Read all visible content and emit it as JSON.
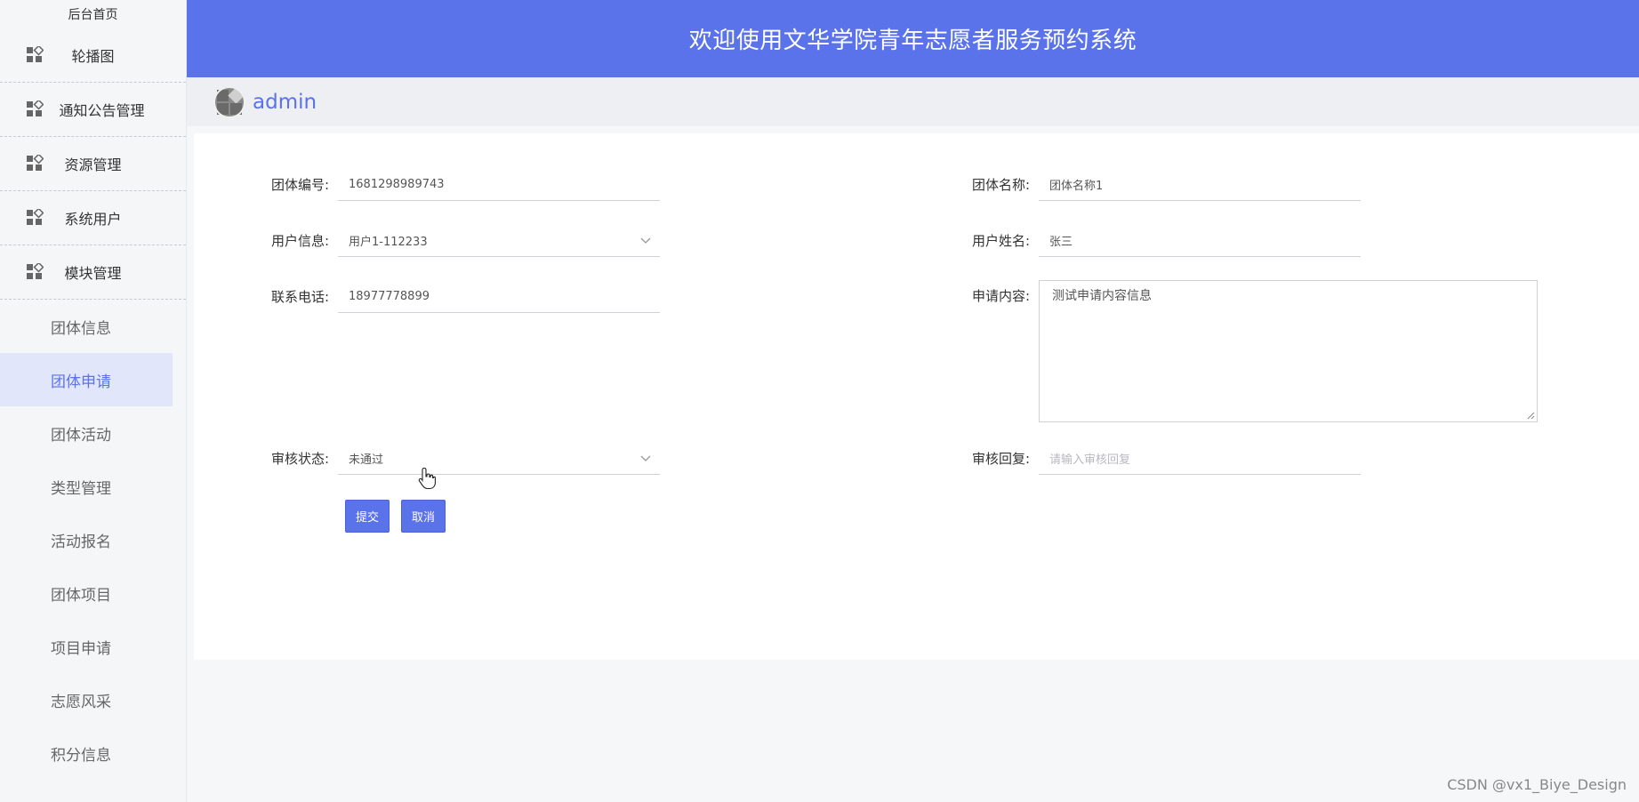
{
  "sidebar": {
    "home": "后台首页",
    "groups": [
      {
        "label": "轮播图",
        "icon": "grid-icon"
      },
      {
        "label": "通知公告管理",
        "icon": "grid-icon"
      },
      {
        "label": "资源管理",
        "icon": "grid-icon"
      },
      {
        "label": "系统用户",
        "icon": "grid-icon"
      },
      {
        "label": "模块管理",
        "icon": "grid-icon"
      }
    ],
    "items": [
      {
        "label": "团体信息"
      },
      {
        "label": "团体申请",
        "active": true
      },
      {
        "label": "团体活动"
      },
      {
        "label": "类型管理"
      },
      {
        "label": "活动报名"
      },
      {
        "label": "团体项目"
      },
      {
        "label": "项目申请"
      },
      {
        "label": "志愿风采"
      },
      {
        "label": "积分信息"
      }
    ]
  },
  "header": {
    "title": "欢迎使用文华学院青年志愿者服务预约系统"
  },
  "user": {
    "name": "admin"
  },
  "form": {
    "group_no": {
      "label": "团体编号:",
      "value": "1681298989743"
    },
    "group_name": {
      "label": "团体名称:",
      "value": "团体名称1"
    },
    "user_info": {
      "label": "用户信息:",
      "value": "用户1-112233"
    },
    "user_name": {
      "label": "用户姓名:",
      "value": "张三"
    },
    "phone": {
      "label": "联系电话:",
      "value": "18977778899"
    },
    "content": {
      "label": "申请内容:",
      "value": "测试申请内容信息"
    },
    "status": {
      "label": "审核状态:",
      "value": "未通过"
    },
    "reply": {
      "label": "审核回复:",
      "placeholder": "请输入审核回复"
    }
  },
  "buttons": {
    "submit": "提交",
    "cancel": "取消"
  },
  "watermark": "CSDN @vx1_Biye_Design",
  "colors": {
    "accent": "#5a72ea",
    "active_bg": "#e1e6fa"
  }
}
